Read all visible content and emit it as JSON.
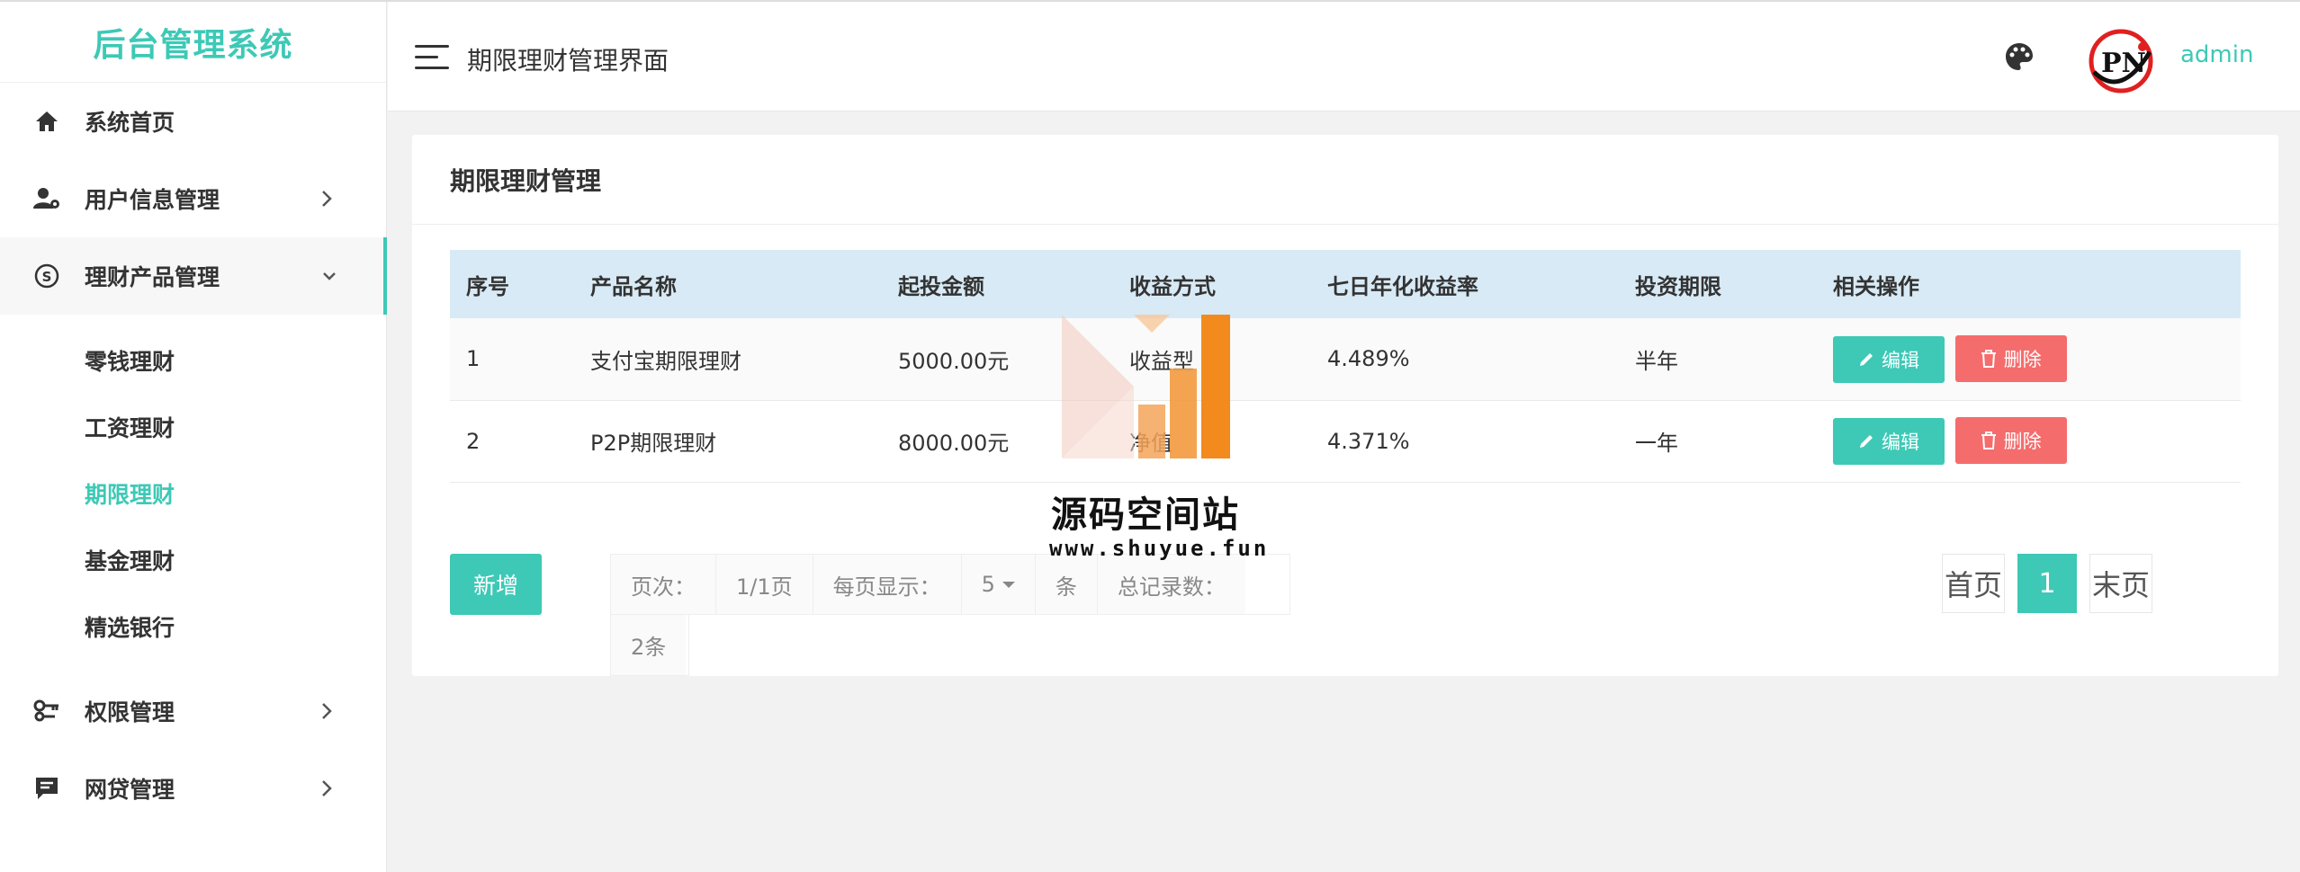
{
  "app": {
    "title": "后台管理系统"
  },
  "sidebar": {
    "items": [
      {
        "label": "系统首页",
        "icon": "home-icon"
      },
      {
        "label": "用户信息管理",
        "icon": "user-settings-icon"
      },
      {
        "label": "理财产品管理",
        "icon": "finance-icon"
      },
      {
        "label": "权限管理",
        "icon": "key-icon"
      },
      {
        "label": "网贷管理",
        "icon": "message-icon"
      }
    ],
    "submenu": [
      "零钱理财",
      "工资理财",
      "期限理财",
      "基金理财",
      "精选银行"
    ],
    "current_sub": "期限理财"
  },
  "header": {
    "title": "期限理财管理界面",
    "user": "admin",
    "menu_icon": "hamburger-icon",
    "theme_icon": "palette-icon"
  },
  "card": {
    "title": "期限理财管理",
    "columns": [
      "序号",
      "产品名称",
      "起投金额",
      "收益方式",
      "七日年化收益率",
      "投资期限",
      "相关操作"
    ],
    "rows": [
      {
        "no": "1",
        "name": "支付宝期限理财",
        "amount": "5000.00元",
        "mode": "收益型",
        "rate": "4.489%",
        "term": "半年"
      },
      {
        "no": "2",
        "name": "P2P期限理财",
        "amount": "8000.00元",
        "mode": "净值",
        "rate": "4.371%",
        "term": "一年"
      }
    ],
    "edit_label": "编辑",
    "delete_label": "删除",
    "add_label": "新增"
  },
  "pagination": {
    "page_label": "页次：",
    "page_value": "1/1页",
    "per_page_label": "每页显示：",
    "per_page_value": "5",
    "unit": "条",
    "total_label": "总记录数：",
    "total_value": "2条",
    "first": "首页",
    "current": "1",
    "last": "末页"
  },
  "watermark": {
    "name": "源码空间站",
    "url": "www.shuyue.fun"
  },
  "colors": {
    "accent": "#3dc9b6",
    "danger": "#f56c6c",
    "table_header": "#d8eaf5"
  }
}
